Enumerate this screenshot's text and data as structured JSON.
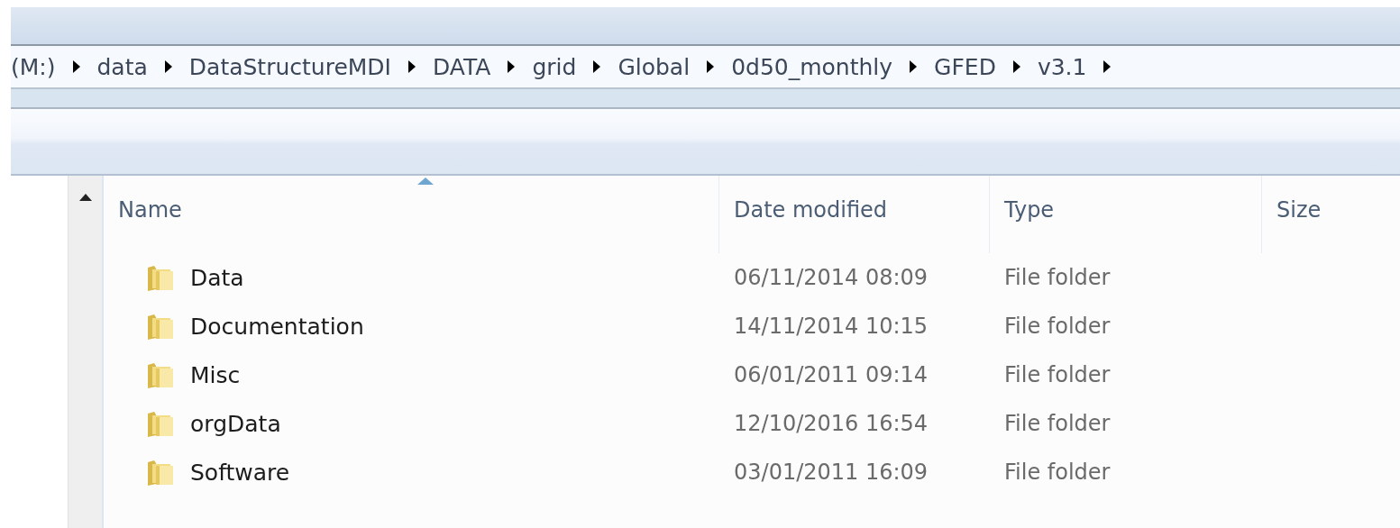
{
  "address_bar": {
    "breadcrumbs": [
      {
        "label": "(M:)"
      },
      {
        "label": "data"
      },
      {
        "label": "DataStructureMDI"
      },
      {
        "label": "DATA"
      },
      {
        "label": "grid"
      },
      {
        "label": "Global"
      },
      {
        "label": "0d50_monthly"
      },
      {
        "label": "GFED"
      },
      {
        "label": "v3.1"
      }
    ]
  },
  "file_list": {
    "columns": [
      {
        "label": "Name",
        "sorted": true
      },
      {
        "label": "Date modified",
        "sorted": false
      },
      {
        "label": "Type",
        "sorted": false
      },
      {
        "label": "Size",
        "sorted": false
      }
    ],
    "rows": [
      {
        "name": "Data",
        "date_modified": "06/11/2014 08:09",
        "type": "File folder"
      },
      {
        "name": "Documentation",
        "date_modified": "14/11/2014 10:15",
        "type": "File folder"
      },
      {
        "name": "Misc",
        "date_modified": "06/01/2011 09:14",
        "type": "File folder"
      },
      {
        "name": "orgData",
        "date_modified": "12/10/2016 16:54",
        "type": "File folder"
      },
      {
        "name": "Software",
        "date_modified": "03/01/2011 16:09",
        "type": "File folder"
      }
    ]
  }
}
